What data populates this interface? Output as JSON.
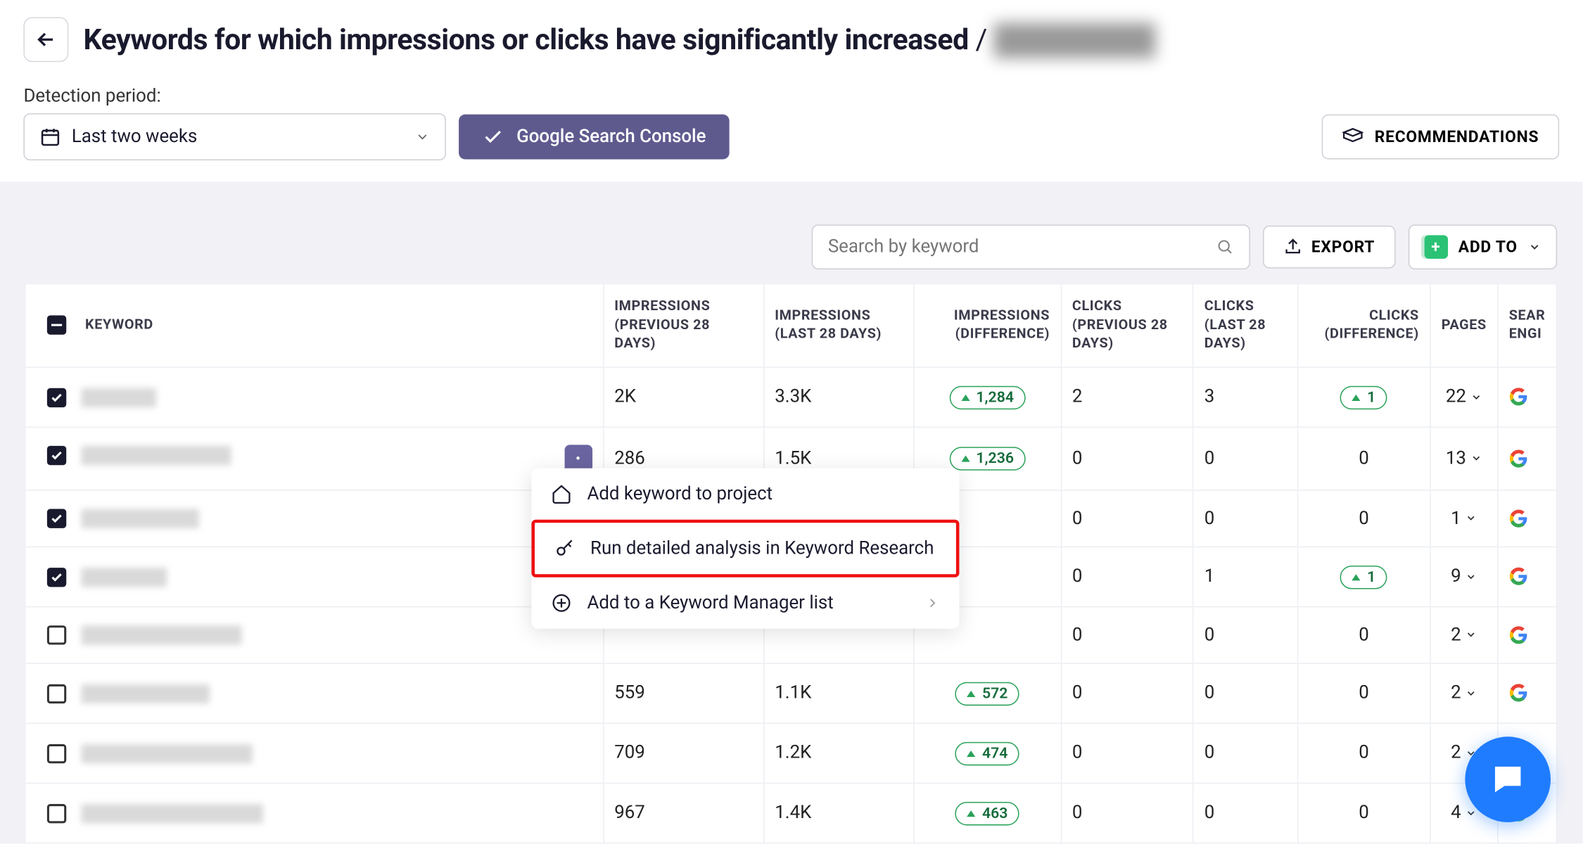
{
  "header": {
    "title_prefix": "Keywords for which impressions or clicks have significantly increased",
    "title_separator": " / ",
    "title_suffix_redacted": "████████"
  },
  "detection": {
    "label": "Detection period:",
    "period": "Last two weeks",
    "source_button": "Google Search Console",
    "recommendations_button": "RECOMMENDATIONS"
  },
  "toolbar": {
    "search_placeholder": "Search by keyword",
    "export_button": "EXPORT",
    "addto_button": "ADD TO"
  },
  "table": {
    "columns": {
      "keyword": "KEYWORD",
      "imp_prev": "IMPRESSIONS (PREVIOUS 28 DAYS)",
      "imp_last": "IMPRESSIONS (LAST 28 DAYS)",
      "imp_diff": "IMPRESSIONS (DIFFERENCE)",
      "clicks_prev": "CLICKS (PREVIOUS 28 DAYS)",
      "clicks_last": "CLICKS (LAST 28 DAYS)",
      "clicks_diff": "CLICKS (DIFFERENCE)",
      "pages": "PAGES",
      "search_engine": "SEAR\nENGI"
    },
    "rows": [
      {
        "checked": true,
        "kw_width": 70,
        "imp_prev": "2K",
        "imp_last": "3.3K",
        "imp_diff": "1,284",
        "clicks_prev": "2",
        "clicks_last": "3",
        "clicks_diff_pill": "1",
        "pages": "22",
        "engine": "gm"
      },
      {
        "checked": true,
        "kw_width": 140,
        "imp_prev": "286",
        "imp_last": "1.5K",
        "imp_diff": "1,236",
        "clicks_prev": "0",
        "clicks_last": "0",
        "clicks_diff": "0",
        "pages": "13",
        "engine": "gm",
        "show_menu": true
      },
      {
        "checked": true,
        "kw_width": 110,
        "imp_prev": "",
        "imp_last": "",
        "imp_diff": "",
        "clicks_prev": "0",
        "clicks_last": "0",
        "clicks_diff": "0",
        "pages": "1",
        "engine": "g"
      },
      {
        "checked": true,
        "kw_width": 80,
        "imp_prev": "",
        "imp_last": "",
        "imp_diff": "",
        "clicks_prev": "0",
        "clicks_last": "1",
        "clicks_diff_pill": "1",
        "pages": "9",
        "engine": "g"
      },
      {
        "checked": false,
        "kw_width": 150,
        "imp_prev": "",
        "imp_last": "",
        "imp_diff": "",
        "clicks_prev": "0",
        "clicks_last": "0",
        "clicks_diff": "0",
        "pages": "2",
        "engine": "gm"
      },
      {
        "checked": false,
        "kw_width": 120,
        "imp_prev": "559",
        "imp_last": "1.1K",
        "imp_diff": "572",
        "clicks_prev": "0",
        "clicks_last": "0",
        "clicks_diff": "0",
        "pages": "2",
        "engine": "g"
      },
      {
        "checked": false,
        "kw_width": 160,
        "imp_prev": "709",
        "imp_last": "1.2K",
        "imp_diff": "474",
        "clicks_prev": "0",
        "clicks_last": "0",
        "clicks_diff": "0",
        "pages": "2",
        "engine": "g"
      },
      {
        "checked": false,
        "kw_width": 170,
        "imp_prev": "967",
        "imp_last": "1.4K",
        "imp_diff": "463",
        "clicks_prev": "0",
        "clicks_last": "0",
        "clicks_diff": "0",
        "pages": "4",
        "engine": "g"
      }
    ]
  },
  "context_menu": {
    "add_to_project": "Add keyword to project",
    "run_analysis": "Run detailed analysis in Keyword Research",
    "add_to_km": "Add to a Keyword Manager list"
  }
}
